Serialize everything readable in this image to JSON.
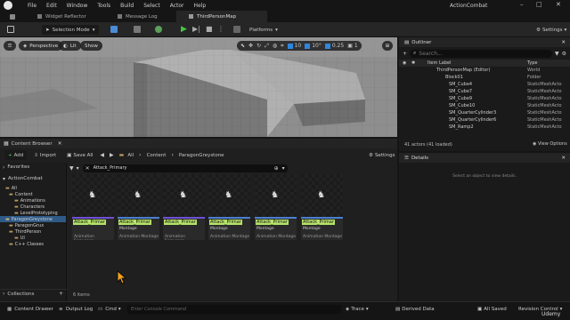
{
  "menu": [
    "File",
    "Edit",
    "Window",
    "Tools",
    "Build",
    "Select",
    "Actor",
    "Help"
  ],
  "project_name": "ActionCombat",
  "tabs": [
    "Widget Reflector",
    "Message Log",
    "ThirdPersonMap"
  ],
  "toolbar": {
    "selection_mode": "Selection Mode",
    "platforms": "Platforms",
    "settings": "Settings"
  },
  "viewport": {
    "perspective": "Perspective",
    "lit": "Lit",
    "show": "Show",
    "grid_snap": "10",
    "rot_snap": "10°",
    "scale_snap": "0.25",
    "camera_speed": "1"
  },
  "outliner": {
    "title": "Outliner",
    "search_placeholder": "Search...",
    "col_label": "Item Label",
    "col_type": "Type",
    "rows": [
      {
        "name": "ThirdPersonMap (Editor)",
        "type": "World"
      },
      {
        "name": "Block01",
        "type": "Folder"
      },
      {
        "name": "SM_Cube4",
        "type": "StaticMeshActo"
      },
      {
        "name": "SM_Cube7",
        "type": "StaticMeshActo"
      },
      {
        "name": "SM_Cube9",
        "type": "StaticMeshActo"
      },
      {
        "name": "SM_Cube10",
        "type": "StaticMeshActo"
      },
      {
        "name": "SM_QuarterCylinder3",
        "type": "StaticMeshActo"
      },
      {
        "name": "SM_QuarterCylinder6",
        "type": "StaticMeshActo"
      },
      {
        "name": "SM_Ramp2",
        "type": "StaticMeshActo"
      }
    ],
    "status": "41 actors (41 loaded)"
  },
  "details": {
    "title": "Details",
    "empty_text": "Select an object to view details."
  },
  "content_browser": {
    "title": "Content Browser",
    "add": "Add",
    "import": "Import",
    "save_all": "Save All",
    "breadcrumb": [
      "All",
      "Content",
      "ParagonGreystone"
    ],
    "settings": "Settings",
    "favorites": "Favorites",
    "project": "ActionCombat",
    "tree": [
      "All",
      "Content",
      "Animations",
      "Characters",
      "LevelPrototyping",
      "ParagonGreystone",
      "ParagonGrux",
      "ThirdPerson",
      "UI",
      "C++ Classes"
    ],
    "search_value": "Attack_Primary",
    "assets": [
      {
        "name": "Attack_Primar",
        "sub": "",
        "type": "Animation Sequence"
      },
      {
        "name": "Attack_Primar",
        "sub": "Montage",
        "type": "Animation Montage"
      },
      {
        "name": "Attack_Primar",
        "sub": "",
        "type": "Animation Sequence"
      },
      {
        "name": "Attack_Primar",
        "sub": "Montage",
        "type": "Animation Montage"
      },
      {
        "name": "Attack_Primar",
        "sub": "Montage",
        "type": "Animation Montage"
      },
      {
        "name": "Attack_Primar",
        "sub": "Montage",
        "type": "Animation Montage"
      }
    ],
    "item_count": "6 items",
    "collections": "Collections"
  },
  "bottom": {
    "content_drawer": "Content Drawer",
    "output_log": "Output Log",
    "cmd": "Cmd",
    "console_placeholder": "Enter Console Command",
    "trace": "Trace",
    "derived_data": "Derived Data",
    "all_saved": "All Saved",
    "revision_control": "Revision Control",
    "watermark": "Udemy"
  }
}
